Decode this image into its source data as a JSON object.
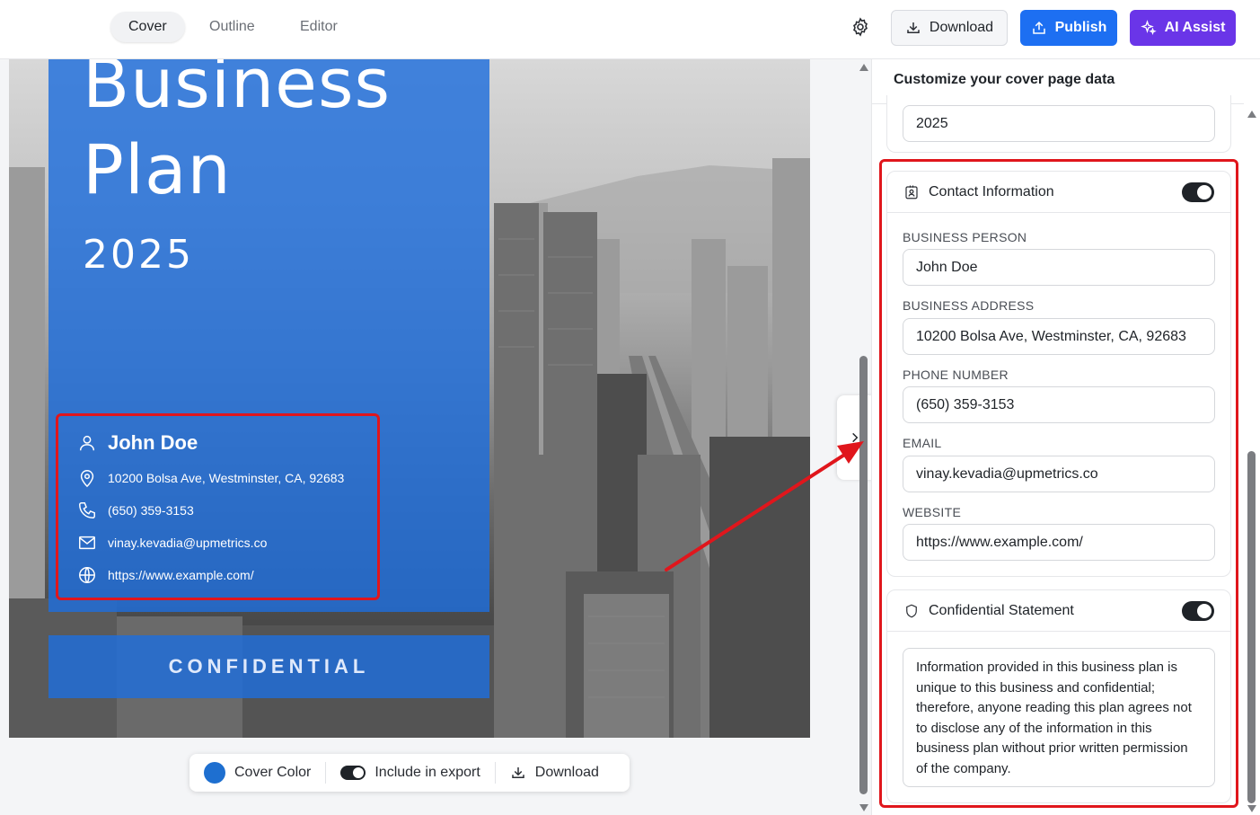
{
  "topbar": {
    "tabs": [
      {
        "label": "Cover",
        "active": true
      },
      {
        "label": "Outline",
        "active": false
      },
      {
        "label": "Editor",
        "active": false
      }
    ],
    "settings_icon": "gear-icon",
    "download_label": "Download",
    "publish_label": "Publish",
    "ai_assist_label": "AI Assist",
    "colors": {
      "publish": "#1d6ff2",
      "ai_assist": "#6a35e8"
    }
  },
  "cover": {
    "title_line1": "Business",
    "title_line2": "Plan",
    "year": "2025",
    "contact": {
      "name": "John Doe",
      "address": "10200 Bolsa Ave, Westminster, CA, 92683",
      "phone": "(650) 359-3153",
      "email": "vinay.kevadia@upmetrics.co",
      "website": "https://www.example.com/"
    },
    "confidential_label": "CONFIDENTIAL",
    "panel_color": "#1e6fd0"
  },
  "toolbar": {
    "cover_color_label": "Cover Color",
    "include_export_label": "Include in export",
    "download_label": "Download"
  },
  "panel": {
    "heading": "Customize your cover page data",
    "year_value": "2025",
    "contact_section": {
      "title": "Contact Information",
      "enabled": true,
      "fields": {
        "business_person_label": "BUSINESS PERSON",
        "business_person_value": "John Doe",
        "business_address_label": "BUSINESS ADDRESS",
        "business_address_value": "10200 Bolsa Ave, Westminster, CA, 92683",
        "phone_label": "PHONE NUMBER",
        "phone_value": "(650) 359-3153",
        "email_label": "EMAIL",
        "email_value": "vinay.kevadia@upmetrics.co",
        "website_label": "WEBSITE",
        "website_value": "https://www.example.com/"
      }
    },
    "confidential_section": {
      "title": "Confidential Statement",
      "enabled": true,
      "text": "Information provided in this business plan is unique to this business and confidential; therefore, anyone reading this plan agrees not to disclose any of the information in this business plan without prior written permission of the company."
    }
  },
  "annotation_color": "#e0161c"
}
